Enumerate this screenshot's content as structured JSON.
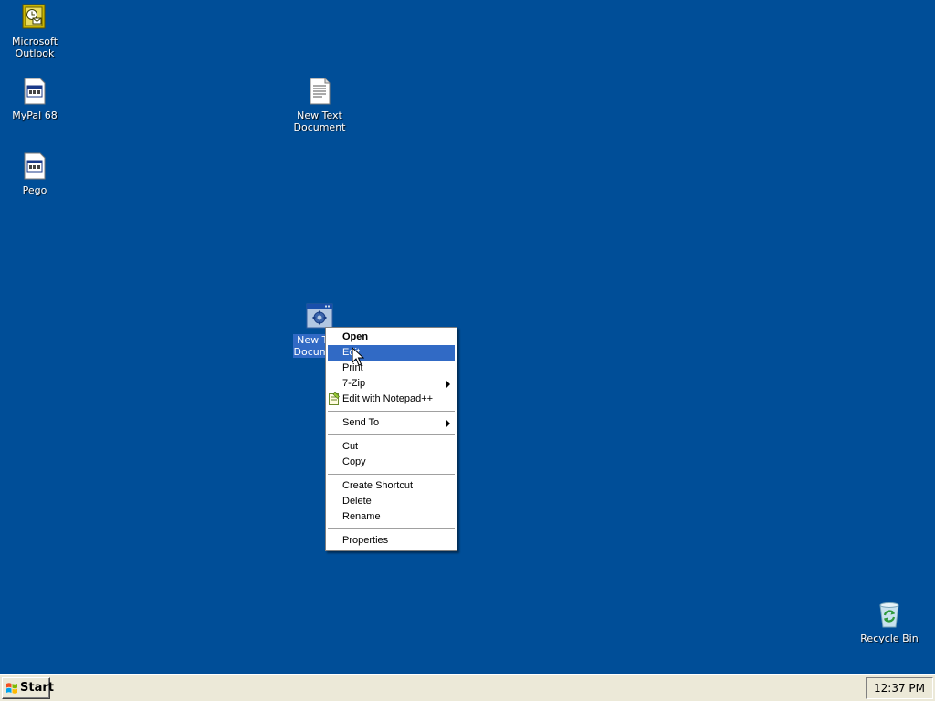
{
  "desktop": {
    "background": "#004e98",
    "icons": [
      {
        "label": "Microsoft\nOutlook",
        "icon": "outlook-icon"
      },
      {
        "label": "MyPal 68",
        "icon": "app-window-icon"
      },
      {
        "label": "Pego",
        "icon": "app-window-icon"
      },
      {
        "label": "New Text\nDocument",
        "icon": "text-document-icon"
      },
      {
        "label": "New Text\nDocument",
        "icon": "application-icon",
        "selected": true
      },
      {
        "label": "Recycle Bin",
        "icon": "recycle-bin-icon"
      }
    ]
  },
  "context_menu": {
    "items": [
      {
        "label": "Open",
        "bold": true
      },
      {
        "label": "Edit",
        "highlighted": true
      },
      {
        "label": "Print"
      },
      {
        "label": "7-Zip",
        "submenu": true
      },
      {
        "label": "Edit with Notepad++",
        "icon": "notepad-plus-plus-icon"
      },
      {
        "label": "Send To",
        "submenu": true
      },
      {
        "label": "Cut"
      },
      {
        "label": "Copy"
      },
      {
        "label": "Create Shortcut"
      },
      {
        "label": "Delete"
      },
      {
        "label": "Rename"
      },
      {
        "label": "Properties"
      }
    ],
    "highlight_color": "#316ac5"
  },
  "taskbar": {
    "start_label": "Start",
    "clock": "12:37 PM"
  }
}
